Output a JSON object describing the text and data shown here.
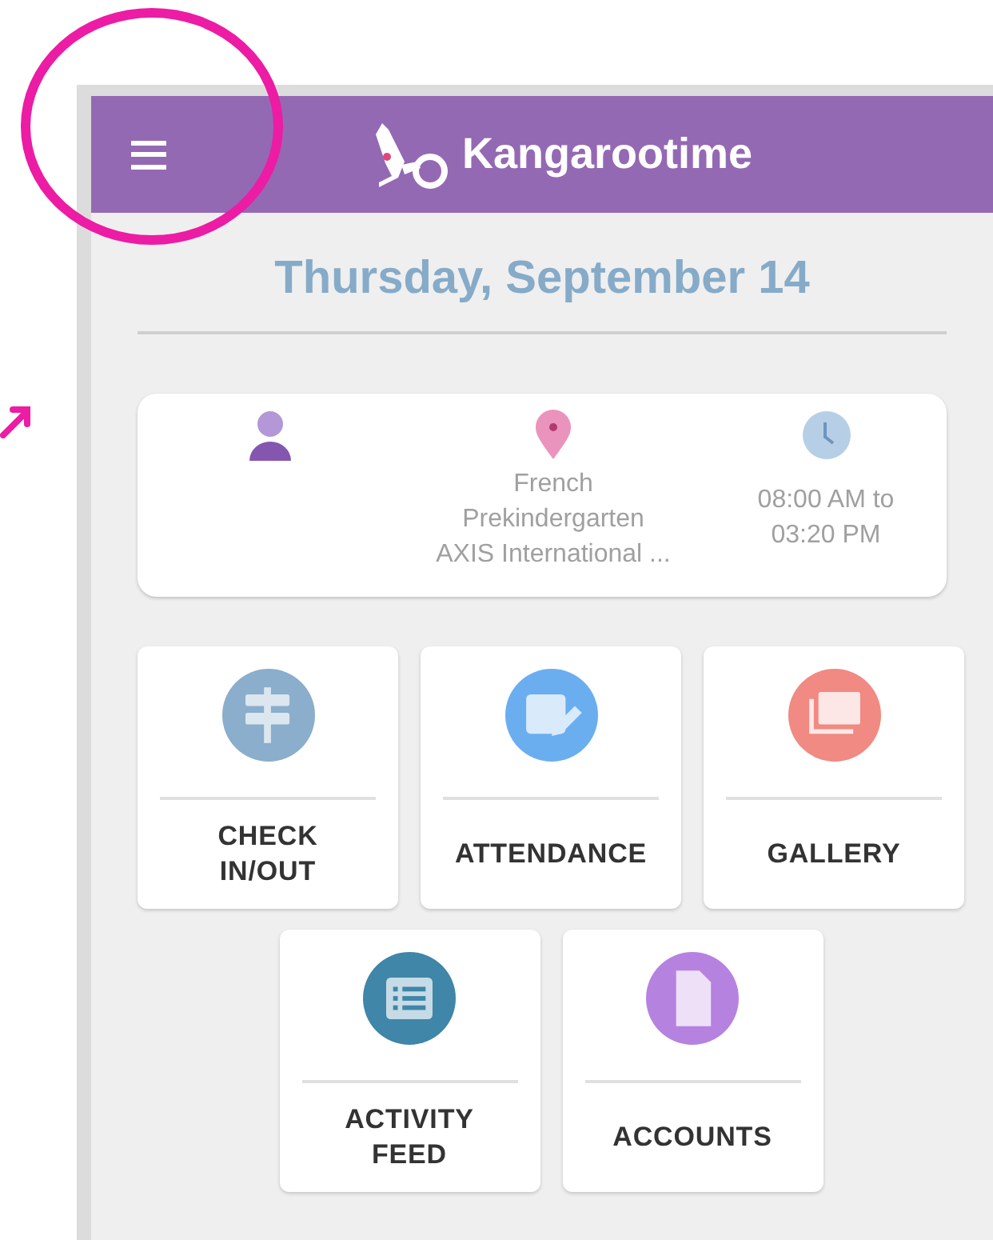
{
  "header": {
    "title": "Kangarootime"
  },
  "date": "Thursday, September 14",
  "info": {
    "location_lines": [
      "French",
      "Prekindergarten",
      "AXIS International ..."
    ],
    "time_lines": [
      "08:00 AM to",
      "03:20 PM"
    ]
  },
  "tiles": [
    {
      "kind": "signpost",
      "label_lines": [
        "CHECK",
        "IN/OUT"
      ],
      "color": "#8aaecb"
    },
    {
      "kind": "calendar",
      "label_lines": [
        "ATTENDANCE"
      ],
      "color": "#6aaef0"
    },
    {
      "kind": "gallery",
      "label_lines": [
        "GALLERY"
      ],
      "color": "#f08a82"
    },
    {
      "kind": "list",
      "label_lines": [
        "ACTIVITY",
        "FEED"
      ],
      "color": "#3f86a8"
    },
    {
      "kind": "invoice",
      "label_lines": [
        "ACCOUNTS"
      ],
      "color": "#b682e0"
    }
  ]
}
